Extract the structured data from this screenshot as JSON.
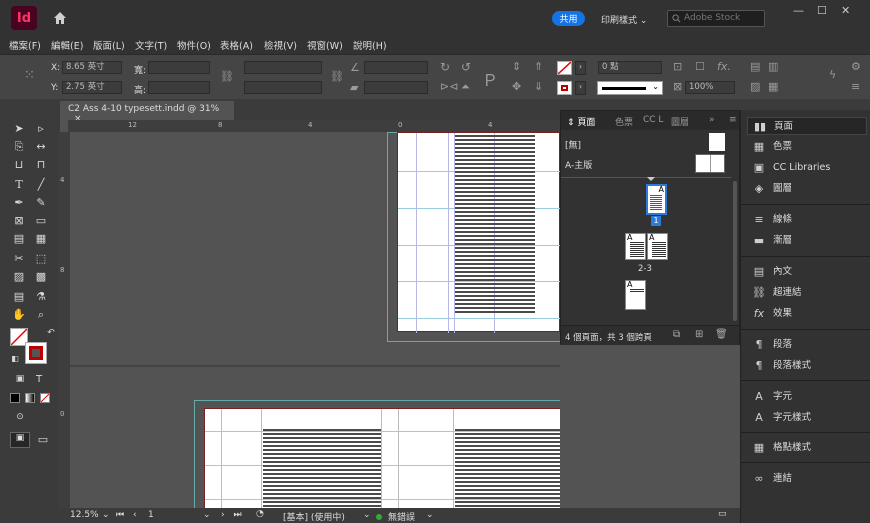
{
  "app": {
    "logo": "Id",
    "share_label": "共用",
    "workspace": "印刷樣式",
    "stock_placeholder": "Adobe Stock"
  },
  "menus": [
    "檔案(F)",
    "編輯(E)",
    "版面(L)",
    "文字(T)",
    "物件(O)",
    "表格(A)",
    "檢視(V)",
    "視窗(W)",
    "說明(H)"
  ],
  "control": {
    "x_label": "X:",
    "x_value": "8.65 英寸",
    "y_label": "Y:",
    "y_value": "2.75 英寸",
    "w_label": "寬:",
    "h_label": "高:",
    "stroke_weight": "0 點",
    "zoom": "100%"
  },
  "document": {
    "tab_title": "C2 Ass 4-10 typesett.indd @ 31%",
    "close": "×"
  },
  "ruler_h": [
    "12",
    "8",
    "4",
    "0",
    "4"
  ],
  "ruler_v": [
    "4",
    "8",
    "0"
  ],
  "status": {
    "zoom": "12.5%",
    "page": "1",
    "profile": "[基本] (使用中)",
    "errors": "無錯誤"
  },
  "pages_panel": {
    "tabs": [
      "頁面",
      "色票",
      "CC L",
      "圖層"
    ],
    "none_label": "[無]",
    "master_label": "A-主版",
    "page1_number": "1",
    "spread2_number": "2-3",
    "master_letter": "A",
    "summary": "4 個頁面，共 3 個跨頁"
  },
  "right_panel": [
    {
      "icon": "pages-icon",
      "label": "頁面",
      "glyph": "▮▮"
    },
    {
      "icon": "swatches-icon",
      "label": "色票",
      "glyph": "▦"
    },
    {
      "icon": "cc-libraries-icon",
      "label": "CC Libraries",
      "glyph": "▣"
    },
    {
      "icon": "layers-icon",
      "label": "圖層",
      "glyph": "◈"
    },
    {
      "icon": "stroke-icon",
      "label": "線條",
      "glyph": "≡"
    },
    {
      "icon": "gradient-icon",
      "label": "漸層",
      "glyph": "▬"
    },
    {
      "icon": "text-wrap-icon",
      "label": "內文",
      "glyph": "▤"
    },
    {
      "icon": "hyperlinks-icon",
      "label": "超連結",
      "glyph": "⛓"
    },
    {
      "icon": "effects-icon",
      "label": "效果",
      "glyph": "fx"
    },
    {
      "icon": "paragraph-icon",
      "label": "段落",
      "glyph": "¶"
    },
    {
      "icon": "paragraph-styles-icon",
      "label": "段落樣式",
      "glyph": "¶"
    },
    {
      "icon": "character-icon",
      "label": "字元",
      "glyph": "A"
    },
    {
      "icon": "character-styles-icon",
      "label": "字元樣式",
      "glyph": "A"
    },
    {
      "icon": "grid-styles-icon",
      "label": "格點樣式",
      "glyph": "▦"
    },
    {
      "icon": "links-icon",
      "label": "連結",
      "glyph": "∞"
    }
  ]
}
